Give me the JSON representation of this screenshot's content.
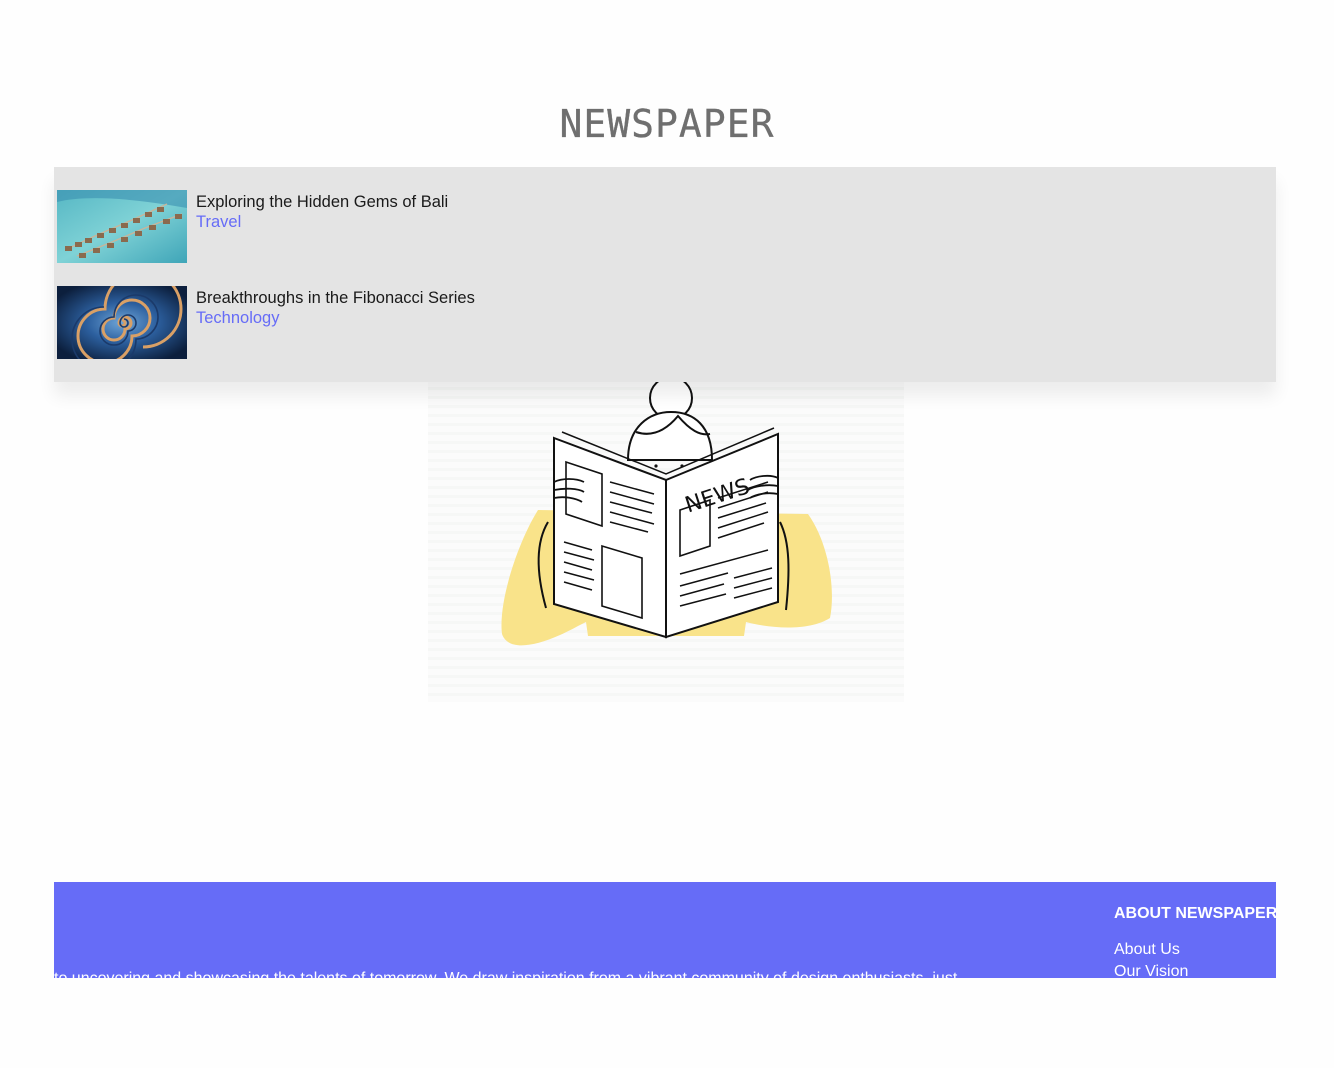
{
  "site": {
    "title": "NEWSPAPER"
  },
  "search_results": [
    {
      "title": "Exploring the Hidden Gems of Bali",
      "category": "Travel",
      "thumbnail_icon": "overwater-bungalows-image"
    },
    {
      "title": "Breakthroughs in the Fibonacci Series",
      "category": "Technology",
      "thumbnail_icon": "spiral-image"
    }
  ],
  "hero": {
    "illustration_text": "NEWS"
  },
  "footer": {
    "blurb": "to uncovering and showcasing the talents of tomorrow. We draw inspiration from a vibrant community of design enthusiasts, just",
    "heading": "ABOUT NEWSPAPER",
    "links": [
      "About Us",
      "Our Vision"
    ]
  },
  "colors": {
    "accent": "#666cf7",
    "dropdown_bg": "#e4e4e4",
    "masthead": "#6f6f6f",
    "illustration_yellow": "#f9e38a"
  }
}
